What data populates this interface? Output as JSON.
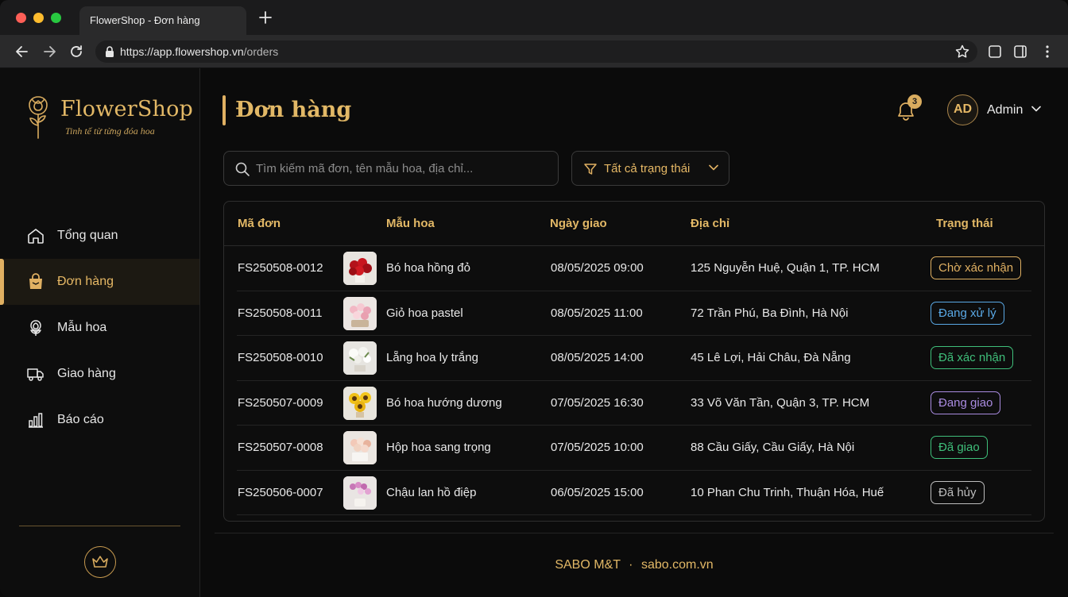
{
  "browser": {
    "tab_title": "FlowerShop - Đơn hàng",
    "url_host": "https://app.flowershop.vn",
    "url_path": "/orders",
    "traffic": [
      "#fe5f57",
      "#febc2e",
      "#28c840"
    ]
  },
  "brand": {
    "name": "FlowerShop",
    "tagline": "Tinh tế từ từng đóa hoa",
    "accent": "#e2b866"
  },
  "sidebar": {
    "items": [
      {
        "label": "Tổng quan",
        "icon": "home-icon",
        "active": false
      },
      {
        "label": "Đơn hàng",
        "icon": "shopping-bag-icon",
        "active": true
      },
      {
        "label": "Mẫu hoa",
        "icon": "flower-icon",
        "active": false
      },
      {
        "label": "Giao hàng",
        "icon": "truck-icon",
        "active": false
      },
      {
        "label": "Báo cáo",
        "icon": "bar-chart-icon",
        "active": false
      }
    ]
  },
  "header": {
    "title": "Đơn hàng",
    "notifications": "3",
    "avatar_initials": "AD",
    "user_name": "Admin"
  },
  "search": {
    "placeholder": "Tìm kiếm mã đơn, tên mẫu hoa, địa chỉ..."
  },
  "filter": {
    "label": "Tất cả trạng thái"
  },
  "table": {
    "columns": [
      "Mã đơn",
      "Mẫu hoa",
      "Ngày giao",
      "Địa chỉ",
      "Trạng thái"
    ],
    "rows": [
      {
        "id": "FS250508-0012",
        "product": "Bó hoa hồng đỏ",
        "date": "08/05/2025 09:00",
        "address": "125 Nguyễn Huệ, Quận 1, TP. HCM",
        "status": "Chờ xác nhận",
        "status_color": "#e0b062",
        "thumb": "red-rose-bouquet"
      },
      {
        "id": "FS250508-0011",
        "product": "Giỏ hoa pastel",
        "date": "08/05/2025 11:00",
        "address": "72 Trần Phú, Ba Đình, Hà Nội",
        "status": "Đang xử lý",
        "status_color": "#5aa9e6",
        "thumb": "pastel-basket"
      },
      {
        "id": "FS250508-0010",
        "product": "Lẵng hoa ly trắng",
        "date": "08/05/2025 14:00",
        "address": "45 Lê Lợi, Hải Châu, Đà Nẵng",
        "status": "Đã xác nhận",
        "status_color": "#3fbf7a",
        "thumb": "white-lily"
      },
      {
        "id": "FS250507-0009",
        "product": "Bó hoa hướng dương",
        "date": "07/05/2025 16:30",
        "address": "33 Võ Văn Tần, Quận 3, TP. HCM",
        "status": "Đang giao",
        "status_color": "#a98be0",
        "thumb": "sunflower"
      },
      {
        "id": "FS250507-0008",
        "product": "Hộp hoa sang trọng",
        "date": "07/05/2025 10:00",
        "address": "88 Cầu Giấy, Cầu Giấy, Hà Nội",
        "status": "Đã giao",
        "status_color": "#3fbf7a",
        "thumb": "luxury-box"
      },
      {
        "id": "FS250506-0007",
        "product": "Chậu lan hồ điệp",
        "date": "06/05/2025 15:00",
        "address": "10 Phan Chu Trinh, Thuận Hóa, Huế",
        "status": "Đã hủy",
        "status_color": "#bdbdbd",
        "thumb": "orchid-pot"
      }
    ]
  },
  "footer": {
    "brand": "SABO M&T",
    "separator": "·",
    "site": "sabo.com.vn"
  }
}
